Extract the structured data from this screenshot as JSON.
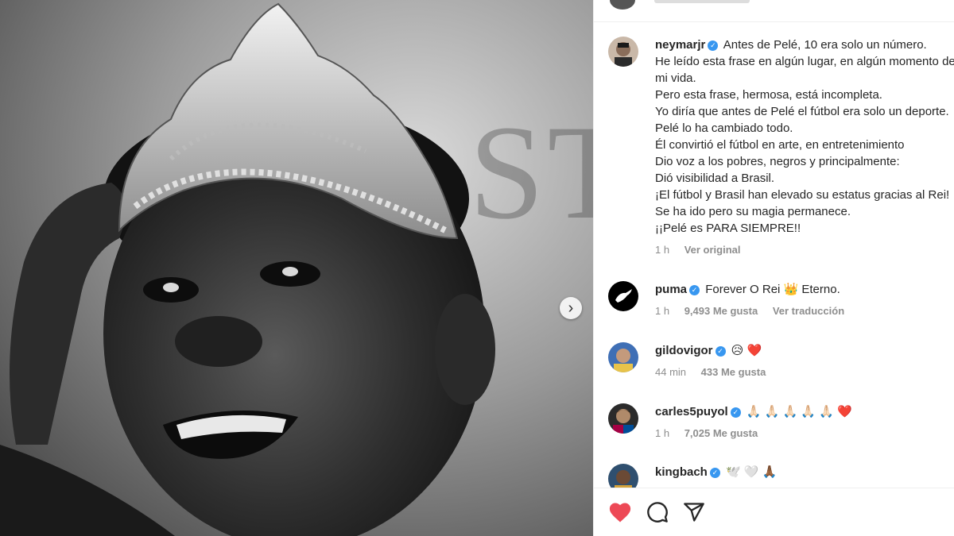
{
  "post": {
    "author": "neymarjr",
    "caption_lines": [
      "Antes de Pelé, 10 era solo un número.",
      "He leído esta frase en algún lugar, en algún momento de",
      "mi vida.",
      "Pero esta frase, hermosa, está incompleta.",
      "Yo diría que antes de Pelé el fútbol era solo un deporte.",
      "Pelé lo ha cambiado todo.",
      "Él convirtió el fútbol en arte, en entretenimiento",
      "Dio voz a los pobres, negros y principalmente:",
      "Dió visibilidad a Brasil.",
      "¡El fútbol y Brasil han elevado su estatus gracias al Rei!",
      "Se ha ido pero su magia permanece.",
      "¡¡Pelé es PARA SIEMPRE!!"
    ],
    "time": "1 h",
    "see_original": "Ver original"
  },
  "comments": [
    {
      "username": "puma",
      "text": "Forever O Rei 👑 Eterno.",
      "time": "1 h",
      "likes": "9,493 Me gusta",
      "translate": "Ver traducción"
    },
    {
      "username": "gildovigor",
      "text": "😥 ❤️",
      "time": "44 min",
      "likes": "433 Me gusta"
    },
    {
      "username": "carles5puyol",
      "text": "🙏🏻 🙏🏻 🙏🏻 🙏🏻 🙏🏻 ❤️",
      "time": "1 h",
      "likes": "7,025 Me gusta"
    },
    {
      "username": "kingbach",
      "text": "🕊️ 🤍 🙏🏾"
    }
  ],
  "icons": {
    "verified": "verified-badge-icon",
    "like": "heart-icon",
    "comment": "comment-icon",
    "share": "share-icon",
    "next": "chevron-right-icon"
  },
  "colors": {
    "like_red": "#ed4956",
    "verified_blue": "#3897f0",
    "muted": "#8e8e8e"
  }
}
